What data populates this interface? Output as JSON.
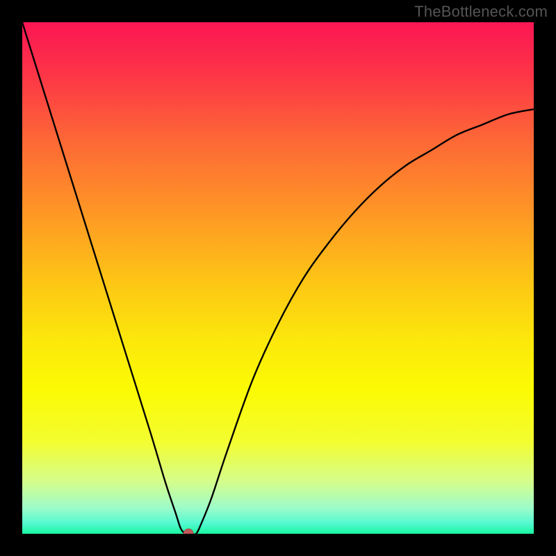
{
  "watermark": "TheBottleneck.com",
  "chart_data": {
    "type": "line",
    "title": "",
    "xlabel": "",
    "ylabel": "",
    "xlim": [
      0,
      100
    ],
    "ylim": [
      0,
      100
    ],
    "grid": false,
    "annotations": [],
    "series": [
      {
        "name": "curve",
        "x": [
          0,
          5,
          10,
          15,
          20,
          25,
          28,
          30,
          31,
          32,
          33,
          34,
          35,
          37,
          40,
          45,
          50,
          55,
          60,
          65,
          70,
          75,
          80,
          85,
          90,
          95,
          100
        ],
        "y": [
          100,
          84,
          68,
          52,
          36,
          20,
          10,
          4,
          1,
          0,
          0,
          0,
          2,
          7,
          16,
          30,
          41,
          50,
          57,
          63,
          68,
          72,
          75,
          78,
          80,
          82,
          83
        ]
      }
    ],
    "marker": {
      "x": 32.5,
      "y": 0,
      "color": "#c05a5a",
      "radius_px": 7
    },
    "background_gradient_vertical": [
      {
        "offset": 0.0,
        "color": "#fc1653"
      },
      {
        "offset": 0.1,
        "color": "#fd3447"
      },
      {
        "offset": 0.22,
        "color": "#fd6437"
      },
      {
        "offset": 0.35,
        "color": "#fe8f28"
      },
      {
        "offset": 0.5,
        "color": "#fdc316"
      },
      {
        "offset": 0.62,
        "color": "#fce70b"
      },
      {
        "offset": 0.72,
        "color": "#fbfb04"
      },
      {
        "offset": 0.82,
        "color": "#f3fd30"
      },
      {
        "offset": 0.9,
        "color": "#d4fd8e"
      },
      {
        "offset": 0.95,
        "color": "#9cfcca"
      },
      {
        "offset": 0.98,
        "color": "#53f9d0"
      },
      {
        "offset": 1.0,
        "color": "#18f8a0"
      }
    ]
  }
}
